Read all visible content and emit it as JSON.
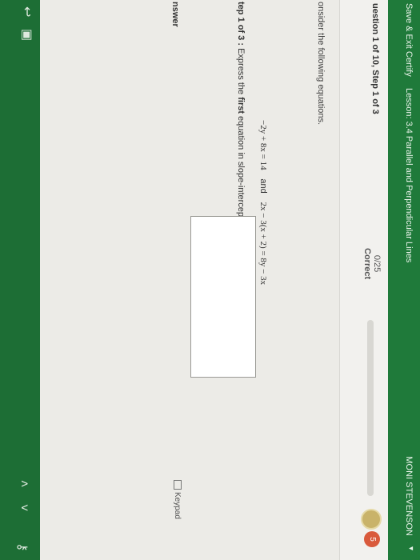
{
  "header": {
    "save_exit": "Save & Exit Certify",
    "lesson": "Lesson: 3.4 Parallel and Perpendicular Lines",
    "user": "MONI STEVENSON"
  },
  "question": {
    "title": "uestion 1 of 10, Step 1 of 3",
    "score": "0/25",
    "score_label": "Correct",
    "progress_fraction": 0.0,
    "streak": "5"
  },
  "body": {
    "consider": "onsider the following equations.",
    "equation1": "−2y + 8x = 14",
    "and": "and",
    "equation2": "2x − 3(x + 2) = 8y − 3x",
    "step_prefix": "tep 1 of 3 :",
    "step_text_a": " Express the ",
    "step_bold": "first",
    "step_text_b": " equation in slope-intercept form. Simplify your answer.",
    "answer_label": "nswer",
    "keypad_label": "Keypad"
  },
  "colors": {
    "header_green": "#1f7a3a",
    "streak_red": "#d95a3c"
  }
}
